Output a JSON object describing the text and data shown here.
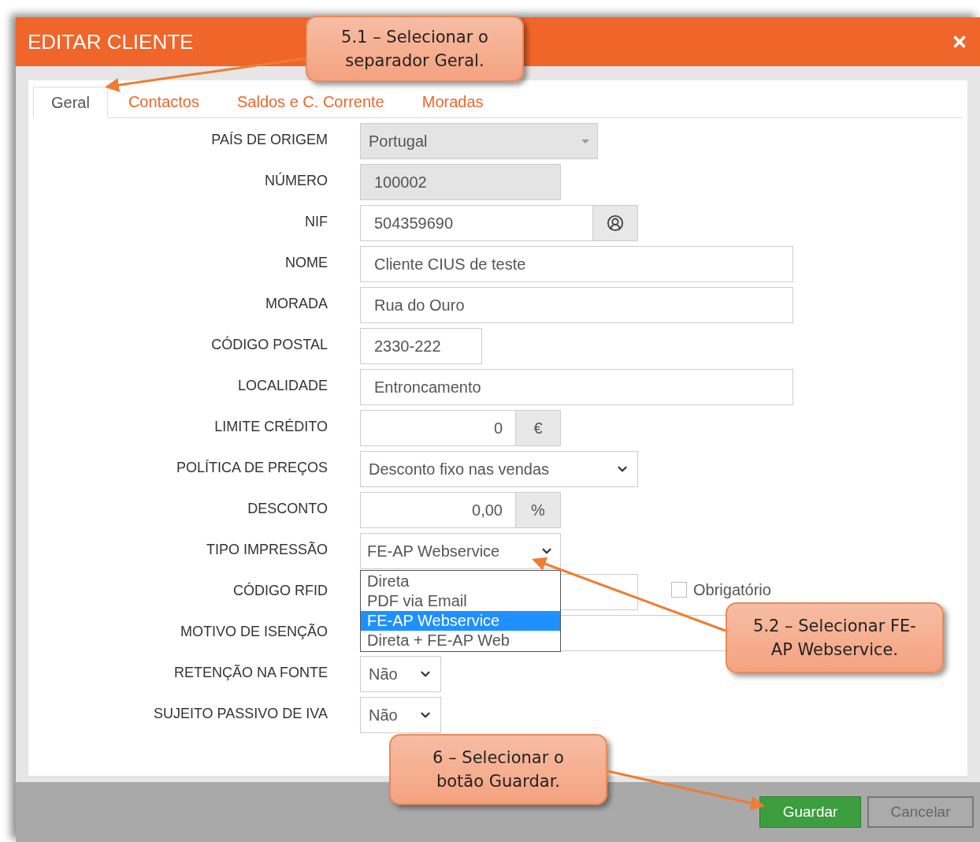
{
  "dialog": {
    "title": "EDITAR CLIENTE"
  },
  "tabs": [
    {
      "label": "Geral",
      "selected": true
    },
    {
      "label": "Contactos",
      "selected": false
    },
    {
      "label": "Saldos e C. Corrente",
      "selected": false
    },
    {
      "label": "Moradas",
      "selected": false
    }
  ],
  "fields": [
    {
      "kind": "select",
      "label": "PAÍS DE ORIGEM",
      "value": "Portugal",
      "disabled": true
    },
    {
      "kind": "input",
      "label": "NÚMERO",
      "value": "100002",
      "disabled": true
    },
    {
      "kind": "input_button",
      "label": "NIF",
      "value": "504359690",
      "disabled": false
    },
    {
      "kind": "input",
      "label": "NOME",
      "value": "Cliente CIUS de teste",
      "disabled": false
    },
    {
      "kind": "input",
      "label": "MORADA",
      "value": "Rua do Ouro",
      "disabled": false
    },
    {
      "kind": "input",
      "label": "CÓDIGO POSTAL",
      "value": "2330-222",
      "disabled": false
    },
    {
      "kind": "input",
      "label": "LOCALIDADE",
      "value": "Entroncamento",
      "disabled": false
    },
    {
      "kind": "input_addon",
      "label": "LIMITE CRÉDITO",
      "value": "0",
      "addon": "€",
      "disabled": false
    },
    {
      "kind": "select",
      "label": "POLÍTICA DE PREÇOS",
      "value": "Desconto fixo nas vendas",
      "disabled": false
    },
    {
      "kind": "input_addon",
      "label": "DESCONTO",
      "value": "0,00",
      "addon": "%",
      "disabled": false
    },
    {
      "kind": "dropdown_open",
      "label": "TIPO IMPRESSÃO",
      "value": "FE-AP Webservice",
      "disabled": false,
      "options": [
        {
          "label": "Direta",
          "selected": false
        },
        {
          "label": "PDF via Email",
          "selected": false
        },
        {
          "label": "FE-AP Webservice",
          "selected": true
        },
        {
          "label": "Direta + FE-AP Web",
          "selected": false
        }
      ]
    },
    {
      "kind": "input_checkbox",
      "label": "CÓDIGO RFID",
      "checkbox_label": "Obrigatório",
      "checked": false,
      "disabled": false
    },
    {
      "kind": "input",
      "label": "MOTIVO DE ISENÇÃO",
      "disabled": false
    },
    {
      "kind": "select",
      "label": "RETENÇÃO NA FONTE",
      "value": "Não",
      "disabled": false
    },
    {
      "kind": "select",
      "label": "SUJEITO PASSIVO DE IVA",
      "value": "Não",
      "disabled": false
    }
  ],
  "buttons": [
    {
      "label": "Guardar",
      "kind": "primary"
    },
    {
      "label": "Cancelar",
      "kind": "secondary"
    }
  ],
  "callouts": [
    {
      "text": "5.1 – Selecionar o separador Geral."
    },
    {
      "text": "5.2 – Selecionar FE-AP Webservice."
    },
    {
      "text": "6 – Selecionar o botão Guardar."
    }
  ]
}
